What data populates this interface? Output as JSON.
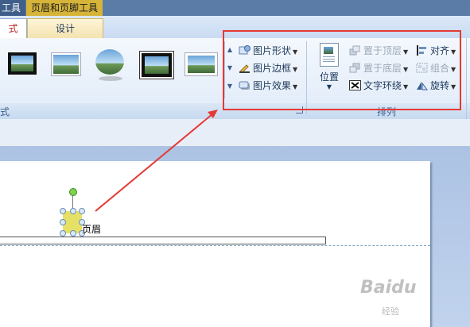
{
  "context_tabs": {
    "group_label_partial": "工具",
    "header_footer_tools": "页眉和页脚工具"
  },
  "ribbon_tabs": {
    "format_partial": "式",
    "design": "设计"
  },
  "picture_styles": {
    "group_label_partial": "式",
    "gallery": [
      "black-frame-style",
      "simple-frame-white-style",
      "oval-soft-edge-style",
      "double-frame-black-style",
      "simple-frame-style"
    ]
  },
  "picture_format": {
    "shape": "图片形状",
    "border": "图片边框",
    "effect": "图片效果"
  },
  "arrange": {
    "position": "位置",
    "bring_front": "置于顶层",
    "send_back": "置于底层",
    "text_wrap": "文字环绕",
    "align": "对齐",
    "group": "组合",
    "rotate": "旋转",
    "group_label": "排列"
  },
  "document": {
    "header_text": "页眉"
  },
  "watermark": {
    "brand": "Baidu",
    "sub": "经验"
  },
  "colors": {
    "highlight": "#e53935",
    "context_accent": "#d6b43a"
  },
  "icons": [
    "picture-shape-icon",
    "picture-border-icon",
    "picture-effect-icon",
    "position-icon",
    "bring-front-icon",
    "send-back-icon",
    "text-wrap-icon",
    "align-icon",
    "group-icon",
    "rotate-icon"
  ]
}
